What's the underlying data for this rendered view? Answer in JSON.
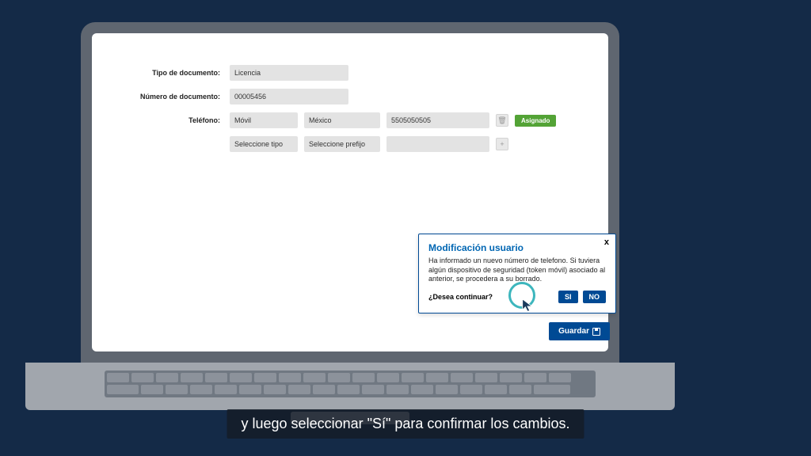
{
  "form": {
    "docTypeLabel": "Tipo de documento:",
    "docTypeValue": "Licencia",
    "docNumLabel": "Número de documento:",
    "docNumValue": "00005456",
    "phoneLabel": "Teléfono:",
    "phoneType": "Móvil",
    "phonePrefix": "México",
    "phoneNumber": "5505050505",
    "assignedBadge": "Asignado",
    "selectType": "Seleccione tipo",
    "selectPrefix": "Seleccione prefijo"
  },
  "dialog": {
    "title": "Modificación usuario",
    "body": "Ha informado un nuevo número de telefono. Si tuviera algún dispositivo de seguridad (token móvil) asociado al anterior, se procedera a su borrado.",
    "question": "¿Desea continuar?",
    "yes": "SI",
    "no": "NO",
    "close": "x"
  },
  "save": "Guardar",
  "caption": "y luego seleccionar \"Sí\" para confirmar los cambios."
}
